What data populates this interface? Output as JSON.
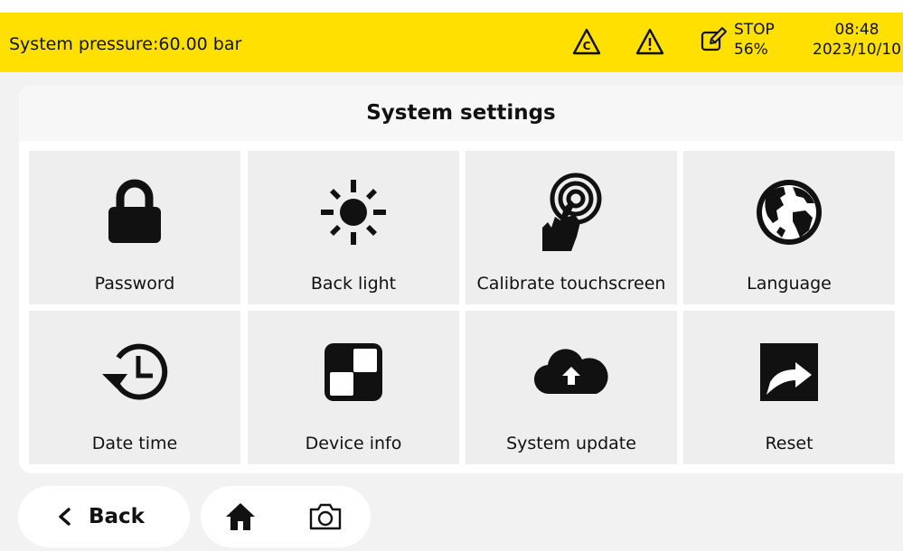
{
  "status": {
    "pressure_text": "System pressure:60.00 bar",
    "stop_label": "STOP",
    "stop_percent": "56%",
    "time": "08:48",
    "date": "2023/10/10"
  },
  "panel": {
    "title": "System settings"
  },
  "tiles": [
    {
      "label": "Password",
      "icon": "lock-icon"
    },
    {
      "label": "Back light",
      "icon": "sun-icon"
    },
    {
      "label": "Calibrate touchscreen",
      "icon": "touch-target-icon"
    },
    {
      "label": "Language",
      "icon": "globe-icon"
    },
    {
      "label": "Date time",
      "icon": "clock-history-icon"
    },
    {
      "label": "Device info",
      "icon": "device-info-icon"
    },
    {
      "label": "System update",
      "icon": "cloud-upload-icon"
    },
    {
      "label": "Reset",
      "icon": "reset-icon"
    }
  ],
  "nav": {
    "back_label": "Back"
  },
  "colors": {
    "status_bar": "#ffe000",
    "tile": "#eeeeee",
    "page": "#f2f2f2"
  }
}
